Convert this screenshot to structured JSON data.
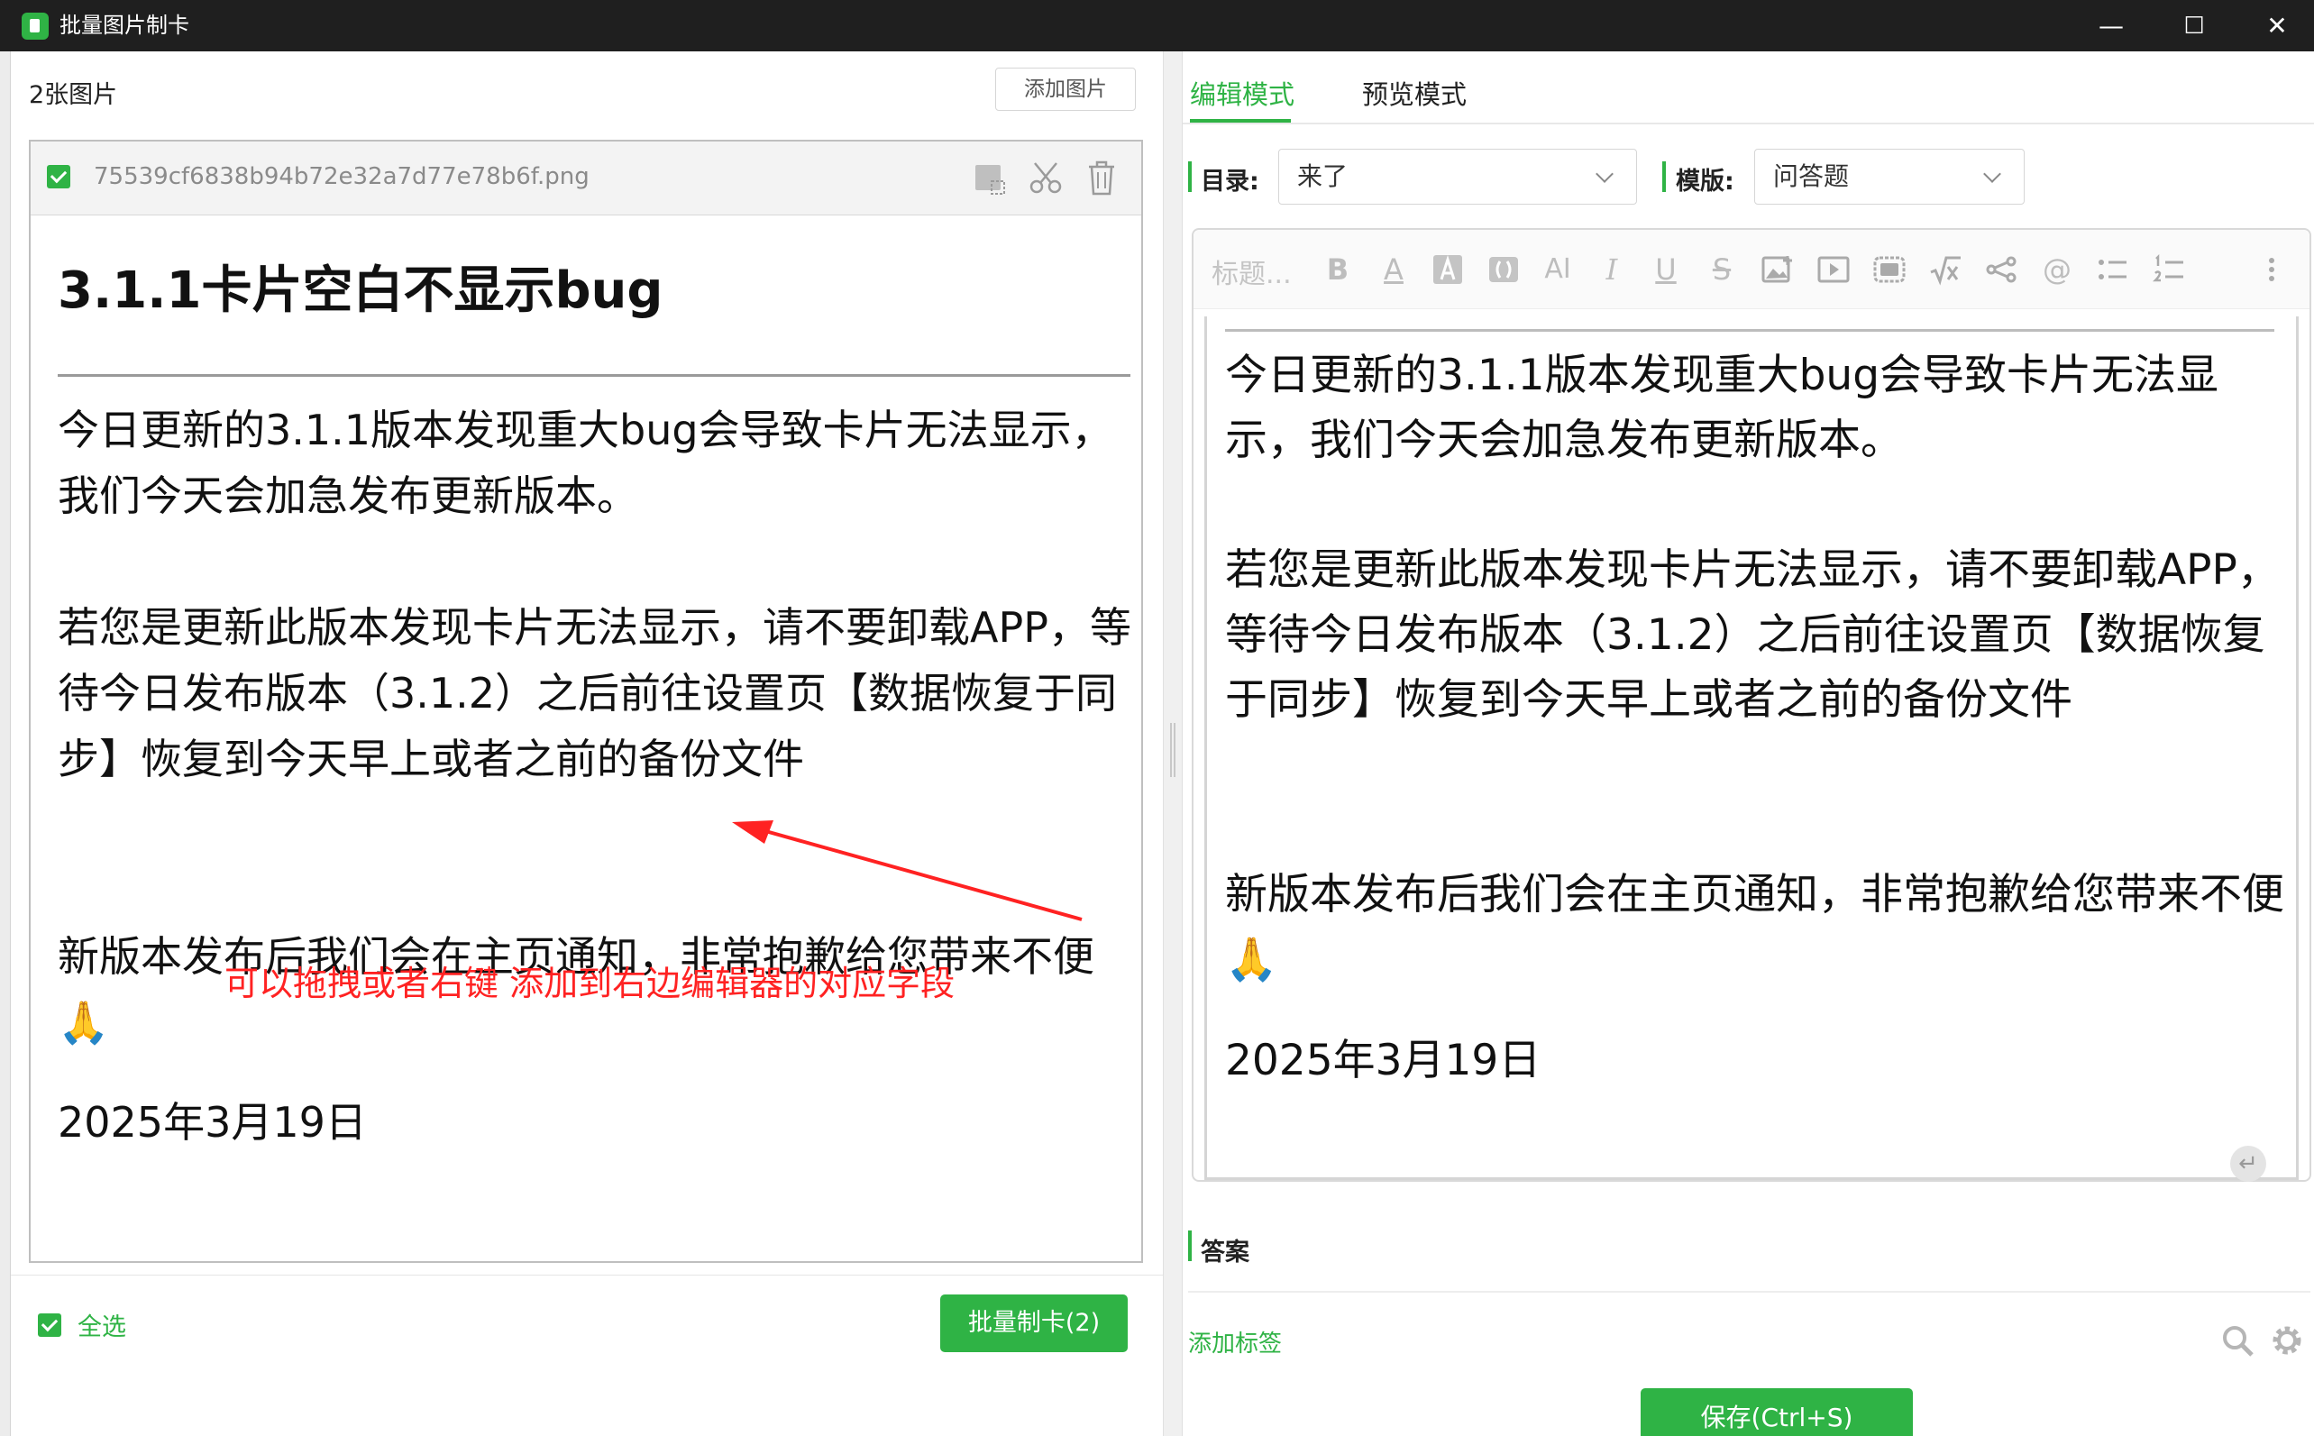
{
  "window": {
    "title": "批量图片制卡",
    "minimize": "—",
    "maximize": "☐",
    "close": "✕"
  },
  "left": {
    "image_count": "2张图片",
    "add_image": "添加图片",
    "card": {
      "filename": "75539cf6838b94b72e32a7d77e78b6f.png",
      "title": "3.1.1卡片空白不显示bug",
      "paragraph1": "今日更新的3.1.1版本发现重大bug会导致卡片无法显示，我们今天会加急发布更新版本。",
      "paragraph2": "若您是更新此版本发现卡片无法显示，请不要卸载APP，等待今日发布版本（3.1.2）之后前往设置页【数据恢复于同步】恢复到今天早上或者之前的备份文件",
      "paragraph3": "新版本发布后我们会在主页通知，非常抱歉给您带来不便🙏",
      "date": "2025年3月19日"
    },
    "annotation": "可以拖拽或者右键 添加到右边编辑器的对应字段",
    "select_all": "全选",
    "batch_button": "批量制卡(2)"
  },
  "right": {
    "tabs": [
      {
        "label": "编辑模式",
        "active": true
      },
      {
        "label": "预览模式",
        "active": false
      }
    ],
    "directory_label": "目录:",
    "directory_value": "来了",
    "template_label": "模版:",
    "template_value": "问答题",
    "toolbar": {
      "placeholder": "标题...",
      "bold": "B",
      "font_color": "A",
      "highlight": "A",
      "format_ai": "AI",
      "italic": "I",
      "underline": "U",
      "strike": "S",
      "mention": "@"
    },
    "editor": {
      "paragraph1": "今日更新的3.1.1版本发现重大bug会导致卡片无法显示，我们今天会加急发布更新版本。",
      "paragraph2": "若您是更新此版本发现卡片无法显示，请不要卸载APP，等待今日发布版本（3.1.2）之后前往设置页【数据恢复于同步】恢复到今天早上或者之前的备份文件",
      "paragraph3": "新版本发布后我们会在主页通知，非常抱歉给您带来不便🙏",
      "date": "2025年3月19日",
      "return_glyph": "↵"
    },
    "answer_label": "答案",
    "add_tag": "添加标签",
    "save_button": "保存(Ctrl+S)"
  },
  "colors": {
    "accent": "#2fb345",
    "annotation": "#ff2222",
    "titlebar": "#1f1f1f"
  }
}
